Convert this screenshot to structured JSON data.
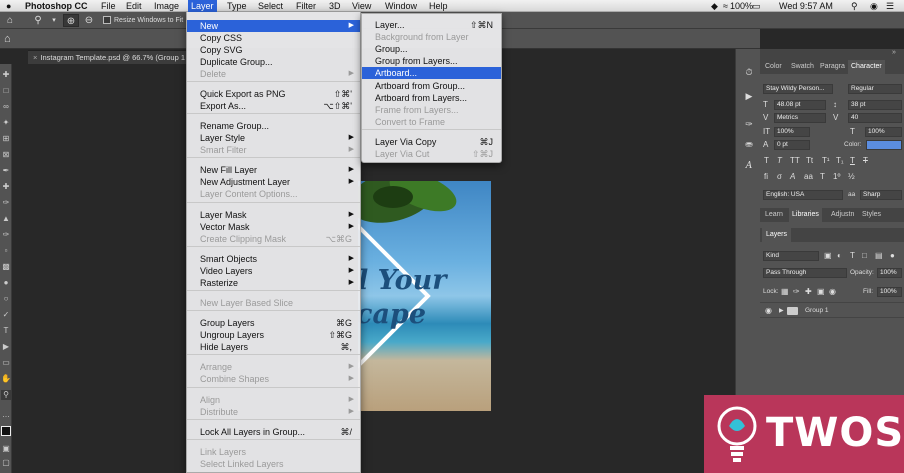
{
  "menubar": {
    "apple": "",
    "app": "Photoshop CC",
    "items": [
      "File",
      "Edit",
      "Image",
      "Layer",
      "Type",
      "Select",
      "Filter",
      "3D",
      "View",
      "Window",
      "Help"
    ],
    "battery": "100%",
    "clock": "Wed 9:57 AM"
  },
  "options": {
    "resize_windows_label": "Resize Windows to Fit"
  },
  "document": {
    "tab_title": "Instagram Template.psd @ 66.7% (Group 1"
  },
  "artboard": {
    "text_line1": "l Your",
    "text_line2": "cape"
  },
  "layer_menu": {
    "items": [
      {
        "label": "New",
        "shortcut": "",
        "submenu": true,
        "state": "highlighted"
      },
      {
        "label": "Copy CSS",
        "shortcut": "",
        "submenu": false,
        "state": "normal"
      },
      {
        "label": "Copy SVG",
        "shortcut": "",
        "submenu": false,
        "state": "normal"
      },
      {
        "label": "Duplicate Group...",
        "shortcut": "",
        "submenu": false,
        "state": "normal"
      },
      {
        "label": "Delete",
        "shortcut": "",
        "submenu": true,
        "state": "disabled"
      },
      {
        "label": "Quick Export as PNG",
        "shortcut": "⇧⌘'",
        "submenu": false,
        "state": "normal"
      },
      {
        "label": "Export As...",
        "shortcut": "⌥⇧⌘'",
        "submenu": false,
        "state": "normal"
      },
      {
        "label": "Rename Group...",
        "shortcut": "",
        "submenu": false,
        "state": "normal"
      },
      {
        "label": "Layer Style",
        "shortcut": "",
        "submenu": true,
        "state": "normal"
      },
      {
        "label": "Smart Filter",
        "shortcut": "",
        "submenu": true,
        "state": "disabled"
      },
      {
        "label": "New Fill Layer",
        "shortcut": "",
        "submenu": true,
        "state": "normal"
      },
      {
        "label": "New Adjustment Layer",
        "shortcut": "",
        "submenu": true,
        "state": "normal"
      },
      {
        "label": "Layer Content Options...",
        "shortcut": "",
        "submenu": false,
        "state": "disabled"
      },
      {
        "label": "Layer Mask",
        "shortcut": "",
        "submenu": true,
        "state": "normal"
      },
      {
        "label": "Vector Mask",
        "shortcut": "",
        "submenu": true,
        "state": "normal"
      },
      {
        "label": "Create Clipping Mask",
        "shortcut": "⌥⌘G",
        "submenu": false,
        "state": "disabled"
      },
      {
        "label": "Smart Objects",
        "shortcut": "",
        "submenu": true,
        "state": "normal"
      },
      {
        "label": "Video Layers",
        "shortcut": "",
        "submenu": true,
        "state": "normal"
      },
      {
        "label": "Rasterize",
        "shortcut": "",
        "submenu": true,
        "state": "normal"
      },
      {
        "label": "New Layer Based Slice",
        "shortcut": "",
        "submenu": false,
        "state": "disabled"
      },
      {
        "label": "Group Layers",
        "shortcut": "⌘G",
        "submenu": false,
        "state": "normal"
      },
      {
        "label": "Ungroup Layers",
        "shortcut": "⇧⌘G",
        "submenu": false,
        "state": "normal"
      },
      {
        "label": "Hide Layers",
        "shortcut": "⌘,",
        "submenu": false,
        "state": "normal"
      },
      {
        "label": "Arrange",
        "shortcut": "",
        "submenu": true,
        "state": "disabled"
      },
      {
        "label": "Combine Shapes",
        "shortcut": "",
        "submenu": true,
        "state": "disabled"
      },
      {
        "label": "Align",
        "shortcut": "",
        "submenu": true,
        "state": "disabled"
      },
      {
        "label": "Distribute",
        "shortcut": "",
        "submenu": true,
        "state": "disabled"
      },
      {
        "label": "Lock All Layers in Group...",
        "shortcut": "⌘/",
        "submenu": false,
        "state": "normal"
      },
      {
        "label": "Link Layers",
        "shortcut": "",
        "submenu": false,
        "state": "disabled"
      },
      {
        "label": "Select Linked Layers",
        "shortcut": "",
        "submenu": false,
        "state": "disabled"
      }
    ]
  },
  "new_submenu": {
    "items": [
      {
        "label": "Layer...",
        "shortcut": "⇧⌘N",
        "state": "normal"
      },
      {
        "label": "Background from Layer",
        "shortcut": "",
        "state": "disabled"
      },
      {
        "label": "Group...",
        "shortcut": "",
        "state": "normal"
      },
      {
        "label": "Group from Layers...",
        "shortcut": "",
        "state": "normal"
      },
      {
        "label": "Artboard...",
        "shortcut": "",
        "state": "highlighted"
      },
      {
        "label": "Artboard from Group...",
        "shortcut": "",
        "state": "normal"
      },
      {
        "label": "Artboard from Layers...",
        "shortcut": "",
        "state": "normal"
      },
      {
        "label": "Frame from Layers...",
        "shortcut": "",
        "state": "disabled"
      },
      {
        "label": "Convert to Frame",
        "shortcut": "",
        "state": "disabled"
      },
      {
        "label": "Layer Via Copy",
        "shortcut": "⌘J",
        "state": "normal"
      },
      {
        "label": "Layer Via Cut",
        "shortcut": "⇧⌘J",
        "state": "disabled"
      }
    ]
  },
  "character_panel": {
    "tabs": [
      "Color",
      "Swatch",
      "Paragra",
      "Character"
    ],
    "active_tab": "Character",
    "font_family": "Stay Wildy Person...",
    "font_style": "Regular",
    "font_size": "48.08 pt",
    "leading": "38 pt",
    "kerning": "Metrics",
    "tracking": "40",
    "vertical_scale": "100%",
    "horizontal_scale": "100%",
    "baseline_shift": "0 pt",
    "color_label": "Color:",
    "color_swatch": "#5b8de0",
    "language": "English: USA",
    "antialias_prefix": "aa",
    "antialias": "Sharp"
  },
  "library_tabs": {
    "tabs": [
      "Learn",
      "Libraries",
      "Adjustn",
      "Styles"
    ],
    "active_tab": "Libraries"
  },
  "layers_panel": {
    "title": "Layers",
    "filter_kind": "Kind",
    "blend_mode": "Pass Through",
    "opacity_label": "Opacity:",
    "opacity": "100%",
    "lock_label": "Lock:",
    "fill_label": "Fill:",
    "fill": "100%",
    "layer_name": "Group 1"
  },
  "watermark": {
    "text": "TWOS"
  }
}
